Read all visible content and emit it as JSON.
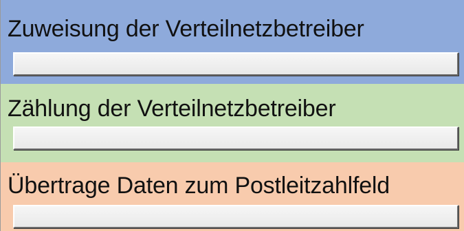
{
  "sections": [
    {
      "label": "Zuweisung der Verteilnetzbetreiber",
      "color": "#8eaadb",
      "progress": 0
    },
    {
      "label": "Zählung der Verteilnetzbetreiber",
      "color": "#c5e0b4",
      "progress": 0
    },
    {
      "label": "Übertrage Daten zum Postleitzahlfeld",
      "color": "#f8cbad",
      "progress": 0
    }
  ]
}
